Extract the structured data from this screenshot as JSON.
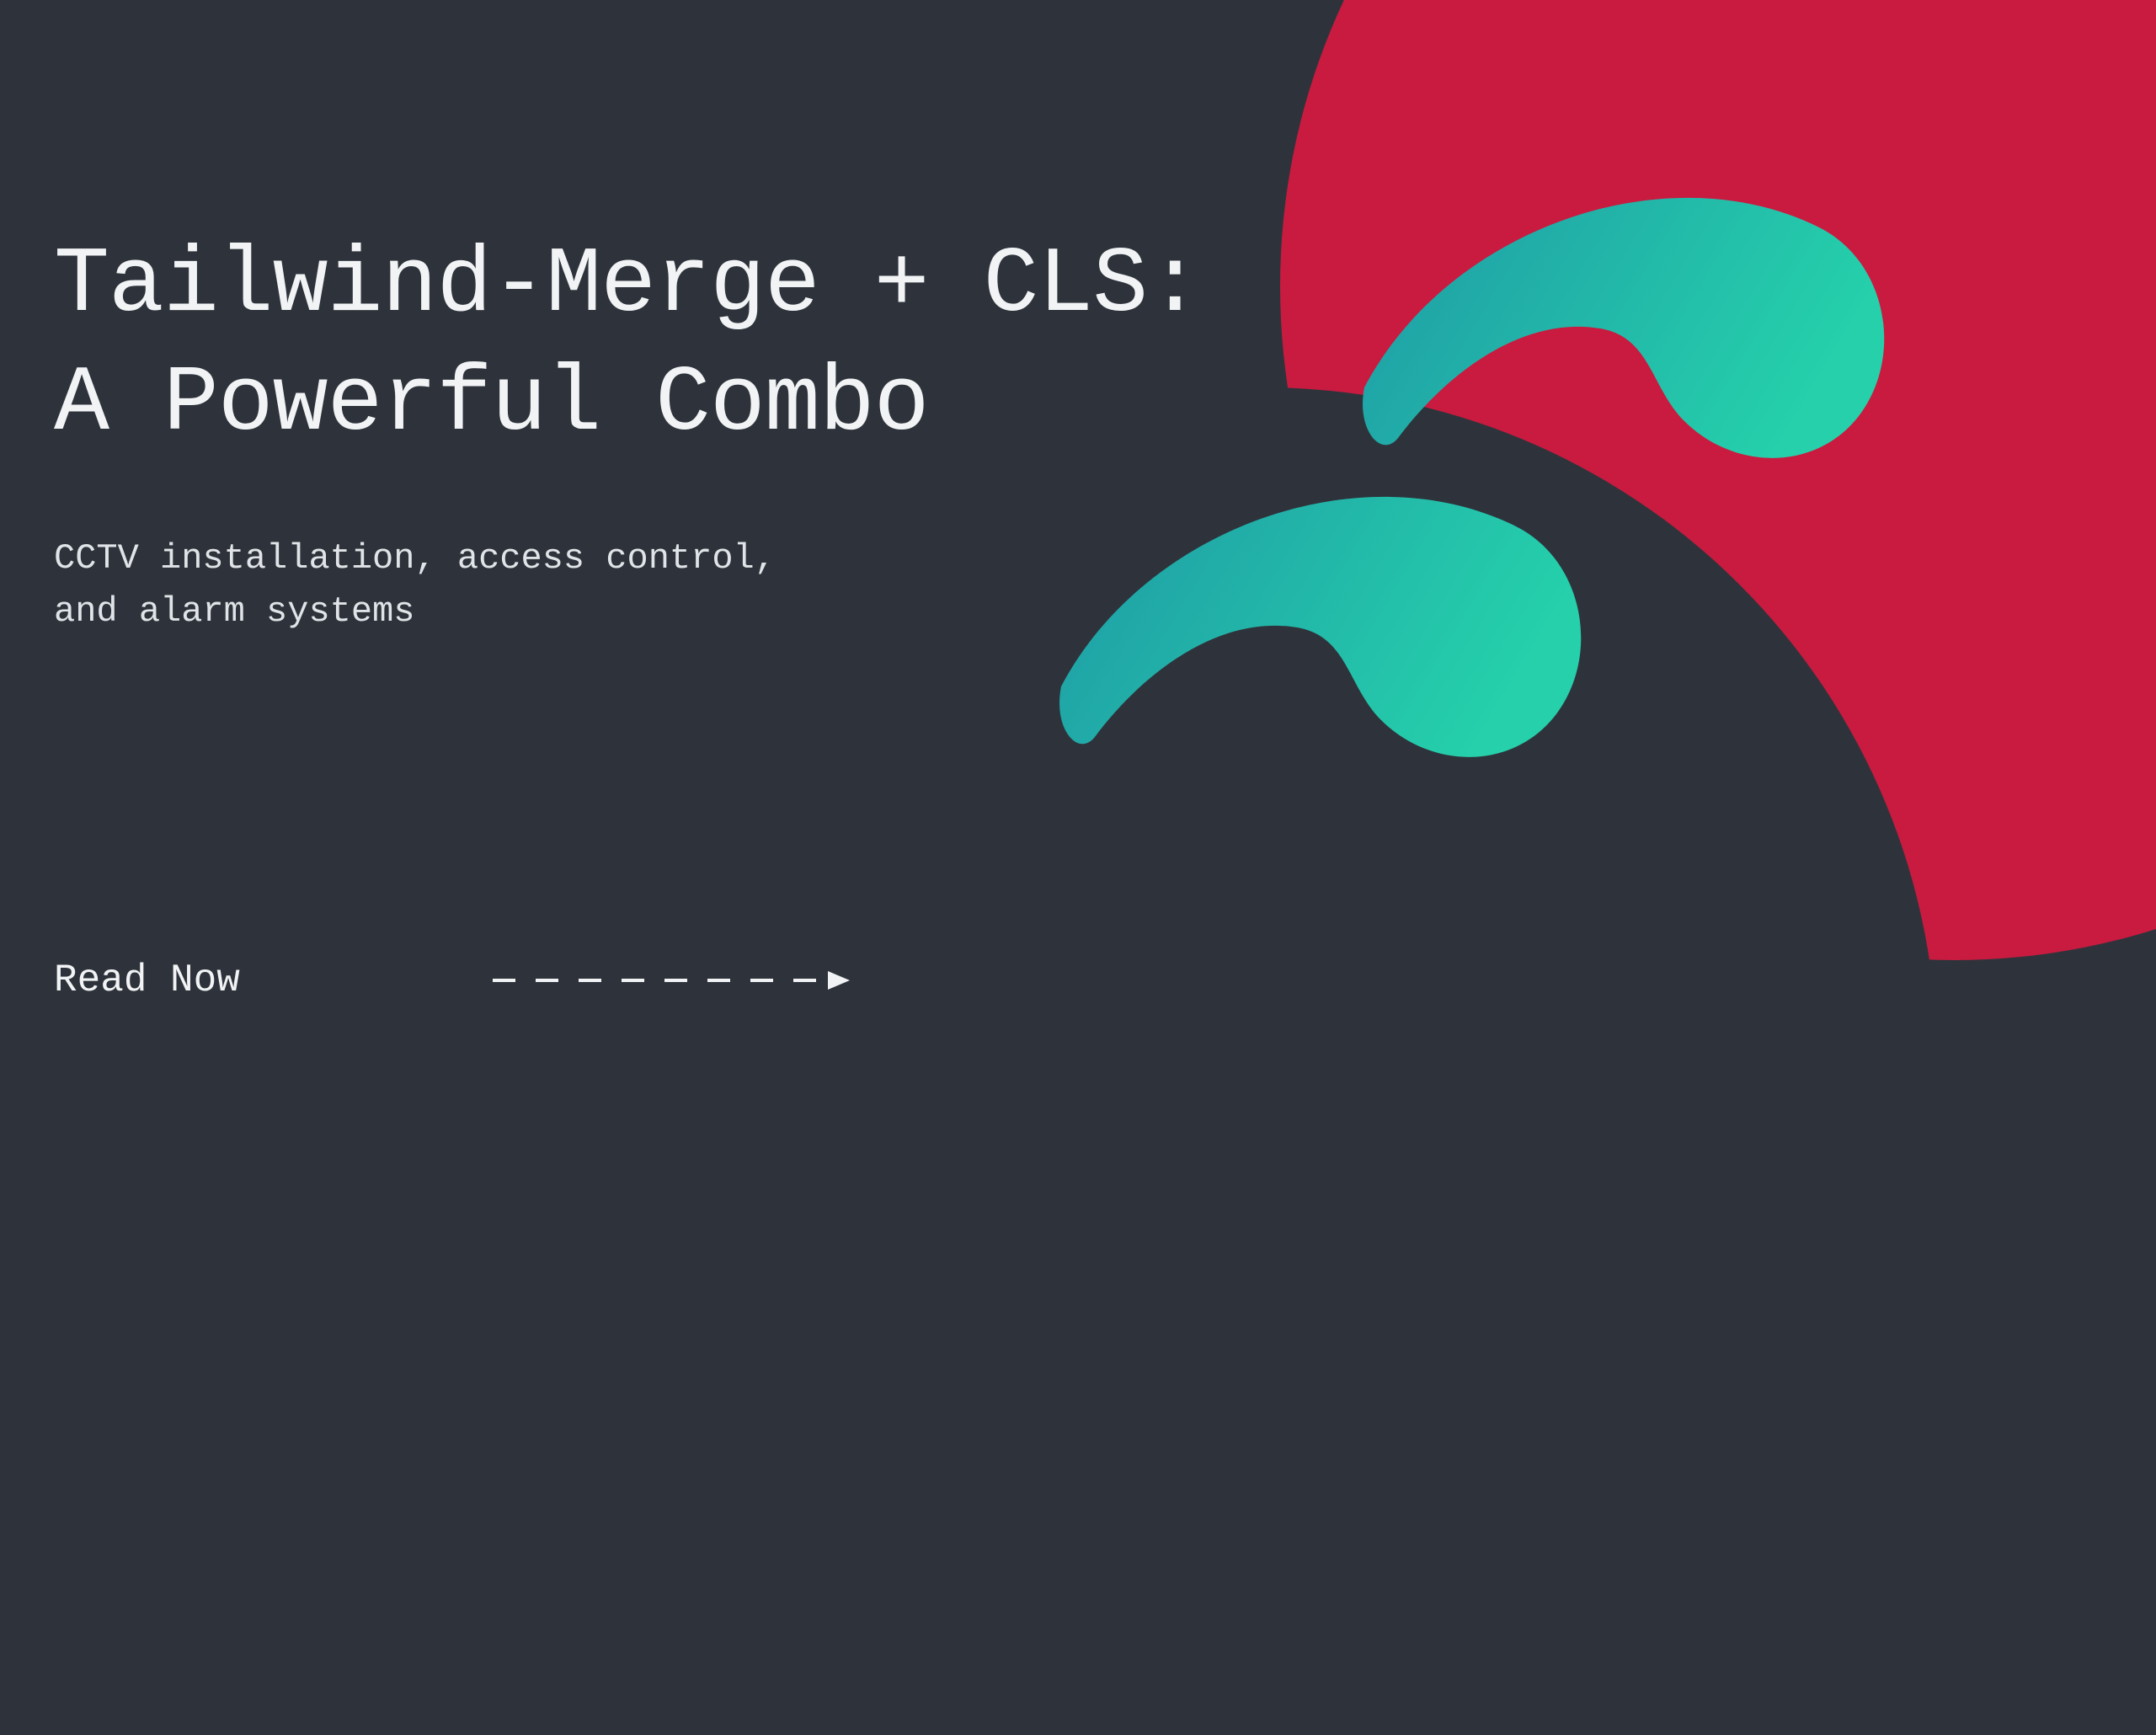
{
  "hero": {
    "title_line1": "Tailwind-Merge + CLS:",
    "title_line2": "A Powerful Combo",
    "subtitle_line1": "CCTV installation, access control,",
    "subtitle_line2": "and alarm systems"
  },
  "cta": {
    "label": "Read Now"
  },
  "colors": {
    "bg": "#2e333b",
    "accent_red": "#c81b3f",
    "teal_start": "#1f9ba6",
    "teal_end": "#2dd4bf",
    "text": "#f1f3f5"
  }
}
